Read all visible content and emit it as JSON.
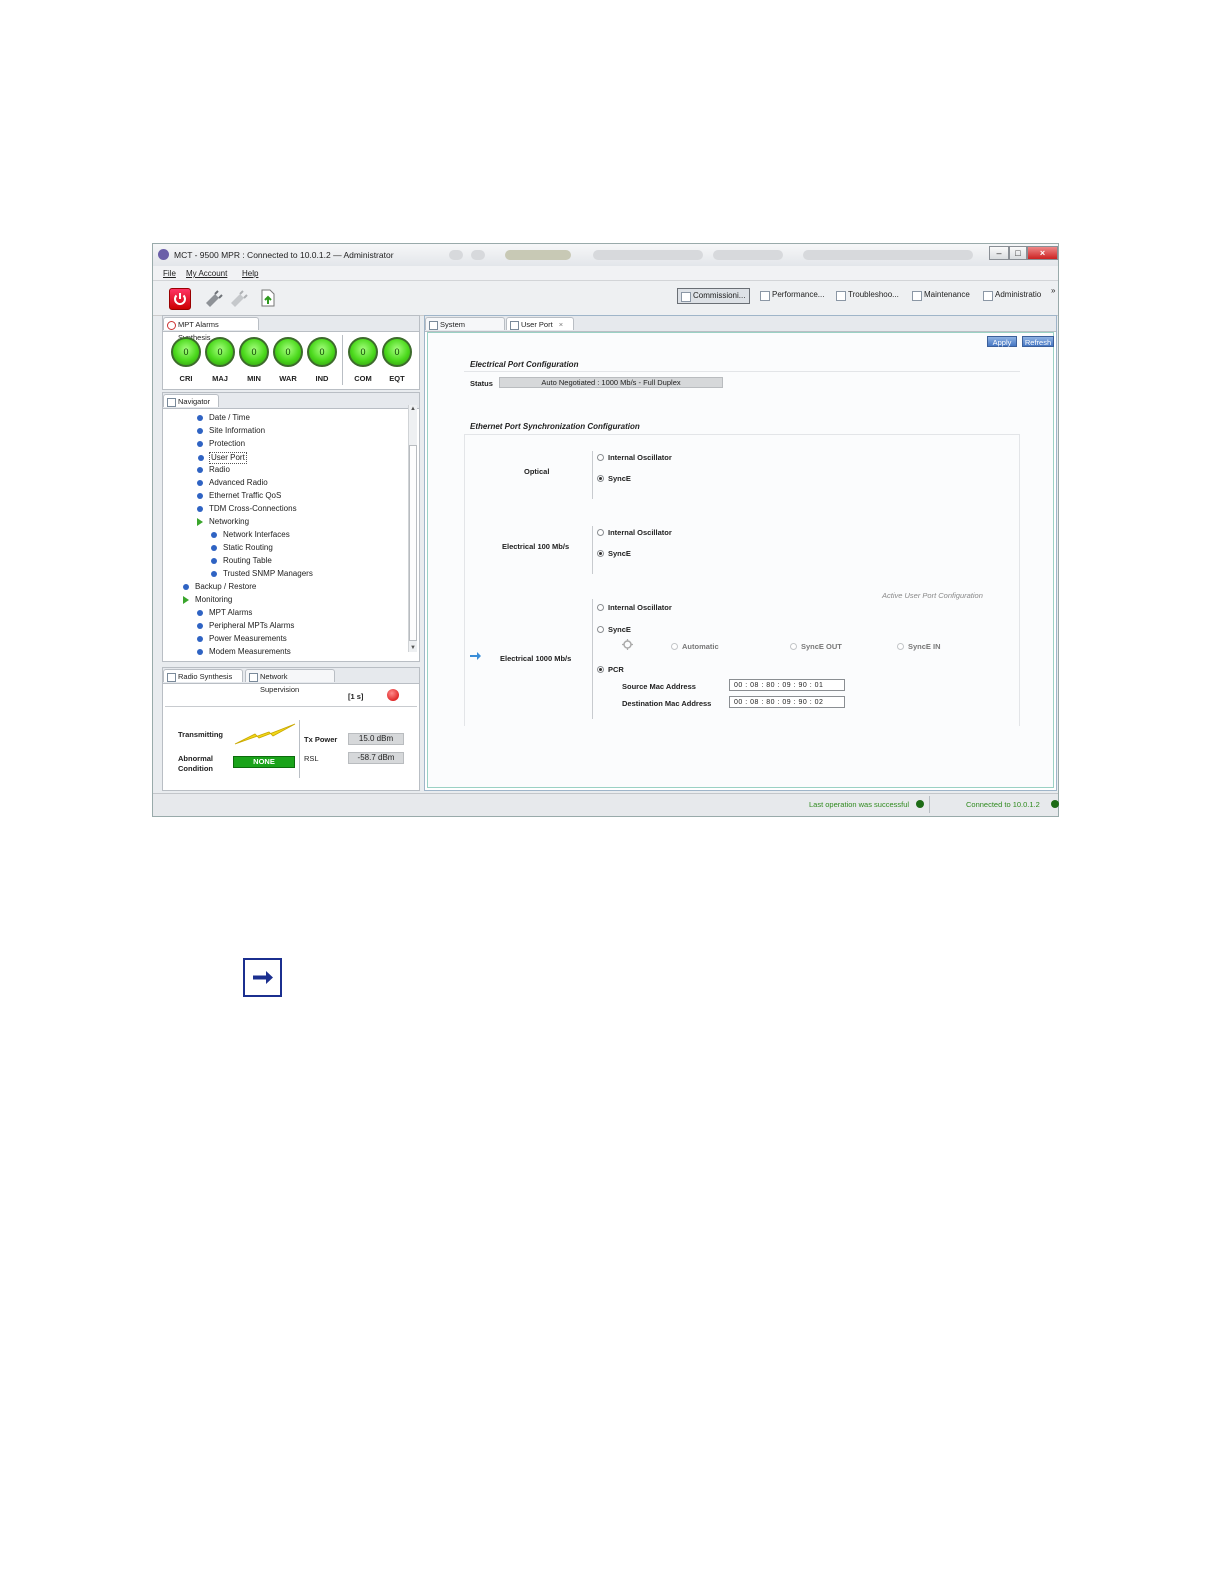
{
  "window": {
    "title": "MCT - 9500 MPR : Connected to 10.0.1.2 — Administrator"
  },
  "menu": [
    "File",
    "My Account",
    "Help"
  ],
  "perspectives": [
    "Commissioni...",
    "Performance...",
    "Troubleshoo...",
    "Maintenance",
    "Administratio"
  ],
  "overflow_glyph": "»",
  "alarms_panel": {
    "tab": "MPT Alarms Synthesis",
    "counters": [
      {
        "label": "CRI",
        "value": "0"
      },
      {
        "label": "MAJ",
        "value": "0"
      },
      {
        "label": "MIN",
        "value": "0"
      },
      {
        "label": "WAR",
        "value": "0"
      },
      {
        "label": "IND",
        "value": "0"
      },
      {
        "label": "COM",
        "value": "0"
      },
      {
        "label": "EQT",
        "value": "0"
      }
    ]
  },
  "navigator": {
    "tab": "Navigator",
    "items": [
      "Date / Time",
      "Site Information",
      "Protection",
      "User Port",
      "Radio",
      "Advanced Radio",
      "Ethernet Traffic QoS",
      "TDM Cross-Connections",
      "Networking",
      "Network Interfaces",
      "Static Routing",
      "Routing Table",
      "Trusted SNMP Managers",
      "Backup / Restore",
      "Monitoring",
      "MPT Alarms",
      "Peripheral MPTs Alarms",
      "Power Measurements",
      "Modem Measurements"
    ]
  },
  "radio_synthesis": {
    "tabs": [
      "Radio Synthesis",
      "Network Supervision"
    ],
    "interval": "[1 s]",
    "transmitting_label": "Transmitting",
    "abnormal_label_1": "Abnormal",
    "abnormal_label_2": "Condition",
    "abnormal_value": "NONE",
    "tx_power_label": "Tx Power",
    "tx_power_value": "15.0 dBm",
    "rsl_label": "RSL",
    "rsl_value": "-58.7 dBm"
  },
  "editor": {
    "tabs": [
      "System Overview",
      "User Port"
    ],
    "apply": "Apply",
    "refresh": "Refresh",
    "electrical_section": "Electrical Port Configuration",
    "status_label": "Status",
    "status_value": "Auto Negotiated : 1000 Mb/s - Full Duplex",
    "sync_section": "Ethernet Port Synchronization Configuration",
    "active_config": "Active User Port Configuration",
    "rows": {
      "optical": "Optical",
      "e100": "Electrical 100 Mb/s",
      "e1000": "Electrical 1000 Mb/s"
    },
    "opt_internal": "Internal Oscillator",
    "opt_synce": "SyncE",
    "opt_pcr": "PCR",
    "sub_automatic": "Automatic",
    "sub_synce_out": "SyncE OUT",
    "sub_synce_in": "SyncE IN",
    "source_mac_label": "Source Mac Address",
    "source_mac": "00 : 08 : 80 : 09 : 90 : 01",
    "dest_mac_label": "Destination Mac Address",
    "dest_mac": "00 : 08 : 80 : 09 : 90 : 02"
  },
  "statusbar": {
    "last_op": "Last operation was successful",
    "connected": "Connected to 10.0.1.2"
  },
  "colors": {
    "alarm_green": "#4bd91c",
    "none_badge": "#1aa31a",
    "status_green": "#2f8a1e",
    "button_blue": "#4576c3"
  }
}
